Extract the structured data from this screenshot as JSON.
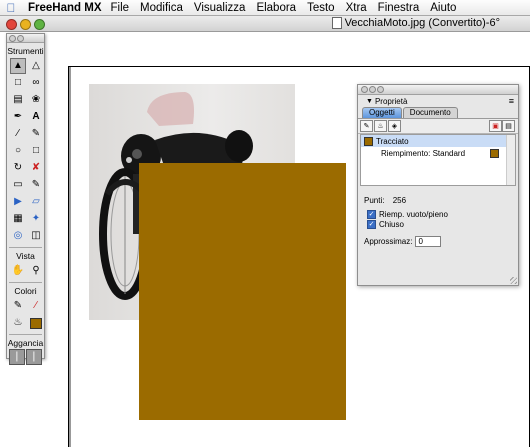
{
  "menubar": {
    "app_name": "FreeHand MX",
    "menus": [
      "File",
      "Modifica",
      "Visualizza",
      "Elabora",
      "Testo",
      "Xtra",
      "Finestra",
      "Aiuto"
    ]
  },
  "document": {
    "title": "VecchiaMoto.jpg (Convertito)-6°"
  },
  "tools": {
    "title": "Strumenti",
    "view_label": "Vista",
    "colors_label": "Colori",
    "snap_label": "Aggancia"
  },
  "properties": {
    "title": "Proprietà",
    "tabs": [
      "Oggetti",
      "Documento"
    ],
    "list": [
      {
        "label": "Tracciato",
        "selected": true
      },
      {
        "label": "Riempimento: Standard",
        "selected": false
      }
    ],
    "points_label": "Punti:",
    "points_value": "256",
    "check_fill": "Riemp. vuoto/pieno",
    "check_closed": "Chiuso",
    "approx_label": "Approssimaz:",
    "approx_value": "0"
  },
  "colors": {
    "fill": "#9b6b00",
    "selection": "#c9dcf6",
    "accent": "#3b6fc6"
  },
  "icons": [
    "apple-icon",
    "selection-arrow-icon",
    "subselect-arrow-icon",
    "lasso-icon",
    "text-icon",
    "pen-icon",
    "pencil-icon",
    "rectangle-icon",
    "ellipse-icon",
    "polygon-icon",
    "hand-icon",
    "zoom-icon",
    "eyedropper-icon",
    "paint-bucket-icon"
  ]
}
